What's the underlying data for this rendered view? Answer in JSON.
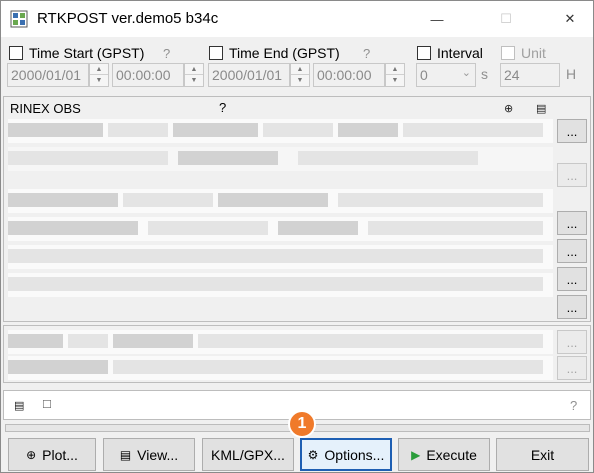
{
  "window": {
    "title": "RTKPOST ver.demo5 b34c",
    "min_glyph": "—",
    "max_glyph": "☐",
    "close_glyph": "✕"
  },
  "time_start": {
    "label": "Time Start (GPST)",
    "help": "?",
    "date": "2000/01/01",
    "time": "00:00:00"
  },
  "time_end": {
    "label": "Time End (GPST)",
    "help": "?",
    "date": "2000/01/01",
    "time": "00:00:00"
  },
  "interval": {
    "label": "Interval",
    "value": "0",
    "unit": "s"
  },
  "unit": {
    "label": "Unit",
    "value": "24",
    "unit": "H"
  },
  "rinex": {
    "label": "RINEX OBS",
    "help": "?",
    "dots": "..."
  },
  "status": {
    "help": "?"
  },
  "buttons": {
    "plot": "Plot...",
    "view": "View...",
    "kml": "KML/GPX...",
    "options": "Options...",
    "execute": "Execute",
    "exit": "Exit"
  },
  "annotation": {
    "badge": "1",
    "color": "#f07a2a"
  },
  "icons": {
    "app": "rtkpost-app-icon",
    "plot": "plot-icon",
    "view": "view-icon",
    "options": "gear-icon",
    "execute": "play-icon"
  }
}
